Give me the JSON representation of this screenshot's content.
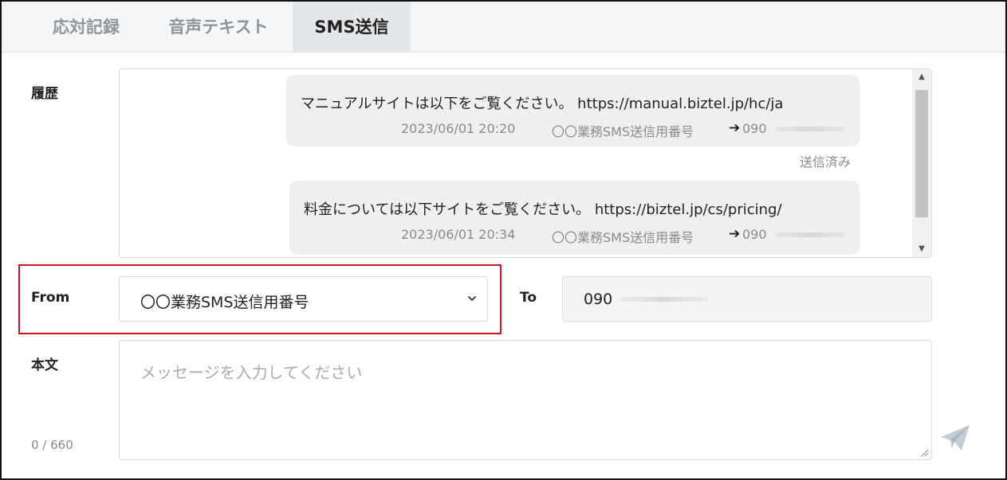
{
  "tabs": [
    {
      "label": "応対記録",
      "active": false
    },
    {
      "label": "音声テキスト",
      "active": false
    },
    {
      "label": "SMS送信",
      "active": true
    }
  ],
  "history": {
    "label": "履歴",
    "messages": [
      {
        "text": "マニュアルサイトは以下をご覧ください。 https://manual.biztel.jp/hc/ja",
        "date": "2023/06/01 20:20",
        "sender": "〇〇業務SMS送信用番号",
        "arrow": "➔",
        "to_prefix": "090",
        "status": "送信済み"
      },
      {
        "text": "料金については以下サイトをご覧ください。 https://biztel.jp/cs/pricing/",
        "date": "2023/06/01 20:34",
        "sender": "〇〇業務SMS送信用番号",
        "arrow": "➔",
        "to_prefix": "090"
      }
    ]
  },
  "from": {
    "label": "From",
    "value": "〇〇業務SMS送信用番号"
  },
  "to": {
    "label": "To",
    "value": "090"
  },
  "body": {
    "label": "本文",
    "placeholder": "メッセージを入力してください",
    "counter": "0 / 660"
  },
  "colors": {
    "highlight": "#d0161c",
    "active_tab_bg": "#e4e7ea",
    "bubble_bg": "#efefef"
  },
  "icons": {
    "select_arrow": "chevron-down-icon",
    "send": "paper-plane-icon"
  }
}
